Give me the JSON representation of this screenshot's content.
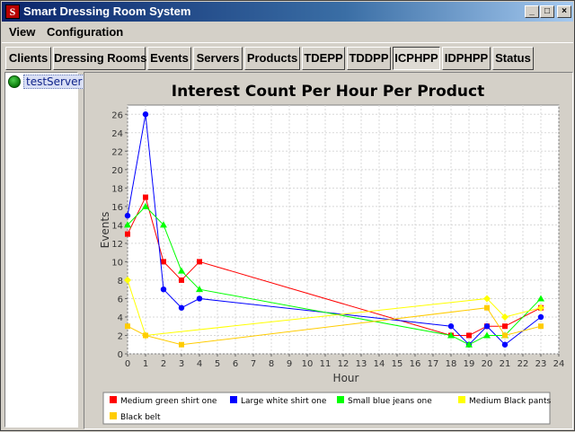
{
  "window": {
    "title": "Smart Dressing Room System",
    "controls": {
      "minimize": "_",
      "maximize": "□",
      "close": "×"
    }
  },
  "menu": {
    "items": [
      "View",
      "Configuration"
    ]
  },
  "tabs": [
    "Clients",
    "Dressing Rooms",
    "Events",
    "Servers",
    "Products",
    "TDEPP",
    "TDDPP",
    "ICPHPP",
    "IDPHPP",
    "Status"
  ],
  "selected_tab": "ICPHPP",
  "sidebar": {
    "server_label": "testServer",
    "server_icon": "server-status-icon"
  },
  "chart_data": {
    "type": "line",
    "title": "Interest Count Per Hour Per Product",
    "xlabel": "Hour",
    "ylabel": "Events",
    "xlim": [
      0,
      24
    ],
    "ylim": [
      0,
      27
    ],
    "xticks": [
      0,
      1,
      2,
      3,
      4,
      5,
      6,
      7,
      8,
      9,
      10,
      11,
      12,
      13,
      14,
      15,
      16,
      17,
      18,
      19,
      20,
      21,
      22,
      23,
      24
    ],
    "yticks": [
      0,
      2,
      4,
      6,
      8,
      10,
      12,
      14,
      16,
      18,
      20,
      22,
      24,
      26
    ],
    "grid": true,
    "legend_position": "bottom",
    "series": [
      {
        "name": "Medium green shirt one",
        "color": "#ff0000",
        "marker": "square",
        "x": [
          0,
          1,
          2,
          3,
          4,
          18,
          19,
          20,
          21,
          23
        ],
        "y": [
          13,
          17,
          10,
          8,
          10,
          2,
          2,
          3,
          3,
          5
        ]
      },
      {
        "name": "Large white shirt one",
        "color": "#0000ff",
        "marker": "circle",
        "x": [
          0,
          1,
          2,
          3,
          4,
          18,
          19,
          20,
          21,
          23
        ],
        "y": [
          15,
          26,
          7,
          5,
          6,
          3,
          1,
          3,
          1,
          4
        ]
      },
      {
        "name": "Small blue jeans one",
        "color": "#00ff00",
        "marker": "triangle",
        "x": [
          0,
          1,
          2,
          3,
          4,
          18,
          19,
          20,
          21,
          23
        ],
        "y": [
          14,
          16,
          14,
          9,
          7,
          2,
          1,
          2,
          2,
          6
        ]
      },
      {
        "name": "Medium Black pants",
        "color": "#ffff00",
        "marker": "diamond",
        "x": [
          0,
          1,
          20,
          21,
          23
        ],
        "y": [
          8,
          2,
          6,
          4,
          5
        ]
      },
      {
        "name": "Black belt",
        "color": "#ffcc00",
        "marker": "square",
        "x": [
          0,
          1,
          3,
          20,
          21,
          23
        ],
        "y": [
          3,
          2,
          1,
          5,
          2,
          3
        ]
      }
    ]
  }
}
